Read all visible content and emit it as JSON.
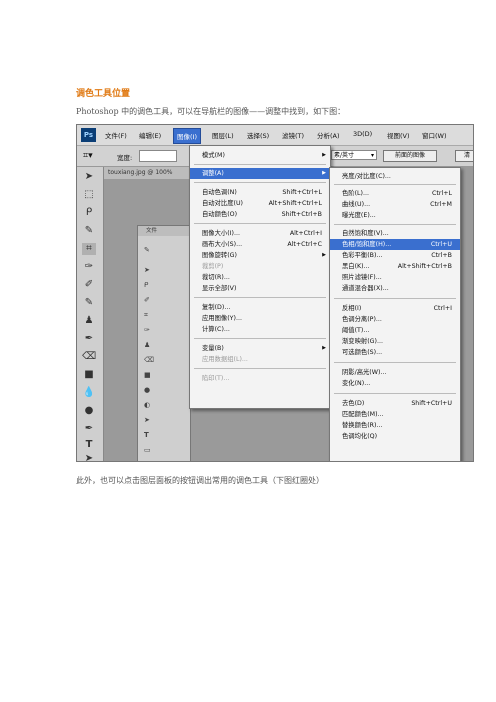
{
  "heading": "调色工具位置",
  "intro": "Photoshop 中的调色工具，可以在导航栏的图像——调整中找到，如下图：",
  "outro": "此外，也可以点击图层面板的按钮调出常用的调色工具（下图红圈处）",
  "menubar": {
    "logo": "Ps",
    "items": [
      "文件(F)",
      "编辑(E)",
      "图像(I)",
      "图层(L)",
      "选择(S)",
      "滤镜(T)",
      "分析(A)",
      "3D(D)",
      "视图(V)",
      "窗口(W)"
    ]
  },
  "options": {
    "width_label": "宽度:",
    "unit_select": "素/英寸",
    "front_image_button": "前面的图像",
    "clear_button": "清"
  },
  "document_tab": "touxiang.jpg @ 100%",
  "inner_window_title": "文件",
  "image_menu": {
    "items": [
      {
        "label": "模式(M)",
        "shortcut": "",
        "submenu": true,
        "disabled": false
      },
      {
        "label": "调整(A)",
        "shortcut": "",
        "submenu": true,
        "disabled": false,
        "highlighted": true
      },
      {
        "label": "自动色调(N)",
        "shortcut": "Shift+Ctrl+L"
      },
      {
        "label": "自动对比度(U)",
        "shortcut": "Alt+Shift+Ctrl+L"
      },
      {
        "label": "自动颜色(O)",
        "shortcut": "Shift+Ctrl+B"
      },
      {
        "label": "图像大小(I)...",
        "shortcut": "Alt+Ctrl+I"
      },
      {
        "label": "画布大小(S)...",
        "shortcut": "Alt+Ctrl+C"
      },
      {
        "label": "图像旋转(G)",
        "shortcut": "",
        "submenu": true
      },
      {
        "label": "裁剪(P)",
        "shortcut": "",
        "disabled": true
      },
      {
        "label": "裁切(R)...",
        "shortcut": ""
      },
      {
        "label": "显示全部(V)",
        "shortcut": ""
      },
      {
        "label": "复制(D)...",
        "shortcut": ""
      },
      {
        "label": "应用图像(Y)...",
        "shortcut": ""
      },
      {
        "label": "计算(C)...",
        "shortcut": ""
      },
      {
        "label": "变量(B)",
        "shortcut": "",
        "submenu": true
      },
      {
        "label": "应用数据组(L)...",
        "shortcut": "",
        "disabled": true
      },
      {
        "label": "陷印(T)...",
        "shortcut": "",
        "disabled": true
      }
    ]
  },
  "adjust_menu": {
    "items": [
      {
        "label": "亮度/对比度(C)...",
        "shortcut": ""
      },
      {
        "label": "色阶(L)...",
        "shortcut": "Ctrl+L"
      },
      {
        "label": "曲线(U)...",
        "shortcut": "Ctrl+M"
      },
      {
        "label": "曝光度(E)...",
        "shortcut": ""
      },
      {
        "label": "自然饱和度(V)...",
        "shortcut": ""
      },
      {
        "label": "色相/饱和度(H)...",
        "shortcut": "Ctrl+U",
        "highlighted": true
      },
      {
        "label": "色彩平衡(B)...",
        "shortcut": "Ctrl+B"
      },
      {
        "label": "黑白(K)...",
        "shortcut": "Alt+Shift+Ctrl+B"
      },
      {
        "label": "照片滤镜(F)...",
        "shortcut": ""
      },
      {
        "label": "通道混合器(X)...",
        "shortcut": ""
      },
      {
        "label": "反相(I)",
        "shortcut": "Ctrl+I"
      },
      {
        "label": "色调分离(P)...",
        "shortcut": ""
      },
      {
        "label": "阈值(T)...",
        "shortcut": ""
      },
      {
        "label": "渐变映射(G)...",
        "shortcut": ""
      },
      {
        "label": "可选颜色(S)...",
        "shortcut": ""
      },
      {
        "label": "阴影/高光(W)...",
        "shortcut": ""
      },
      {
        "label": "变化(N)...",
        "shortcut": ""
      },
      {
        "label": "去色(D)",
        "shortcut": "Shift+Ctrl+U"
      },
      {
        "label": "匹配颜色(M)...",
        "shortcut": ""
      },
      {
        "label": "替换颜色(R)...",
        "shortcut": ""
      },
      {
        "label": "色调均化(Q)",
        "shortcut": ""
      }
    ]
  },
  "colors": {
    "heading": "#e07a14",
    "highlight": "#3a6fcf"
  }
}
